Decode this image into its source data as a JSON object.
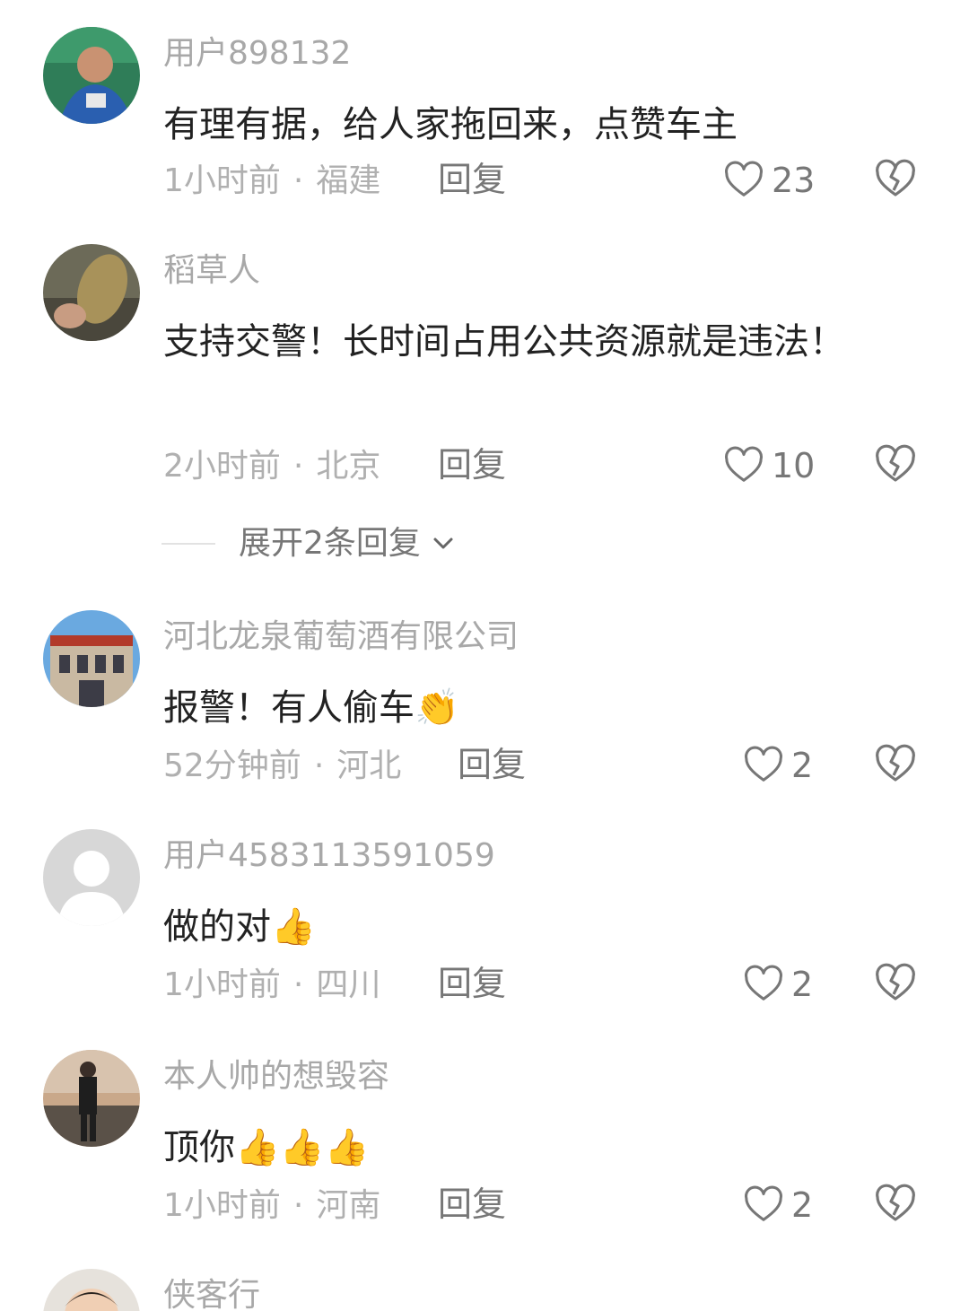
{
  "comments": [
    {
      "username": "用户898132",
      "text": "有理有据，给人家拖回来，点赞车主",
      "emoji": "",
      "time": "1小时前",
      "location": "福建",
      "reply_label": "回复",
      "likes": "23"
    },
    {
      "username": "稻草人",
      "text": "支持交警！长时间占用公共资源就是违法！",
      "emoji": "",
      "time": "2小时前",
      "location": "北京",
      "reply_label": "回复",
      "likes": "10"
    },
    {
      "username": "河北龙泉葡萄酒有限公司",
      "text": "报警！有人偷车",
      "emoji": "👏",
      "time": "52分钟前",
      "location": "河北",
      "reply_label": "回复",
      "likes": "2"
    },
    {
      "username": "用户4583113591059",
      "text": "做的对",
      "emoji": "👍",
      "time": "1小时前",
      "location": "四川",
      "reply_label": "回复",
      "likes": "2"
    },
    {
      "username": "本人帅的想毁容",
      "text": "顶你",
      "emoji": "👍👍👍",
      "time": "1小时前",
      "location": "河南",
      "reply_label": "回复",
      "likes": "2"
    },
    {
      "username": "侠客行"
    }
  ],
  "expand_replies_label": "展开2条回复",
  "meta_separator": "·",
  "icons": {
    "like": "heart-outline-icon",
    "dislike": "broken-heart-icon",
    "expand": "chevron-down-icon"
  },
  "colors": {
    "username": "#a8a8a8",
    "text": "#222222",
    "meta": "#b0b0b0",
    "action": "#777777"
  }
}
